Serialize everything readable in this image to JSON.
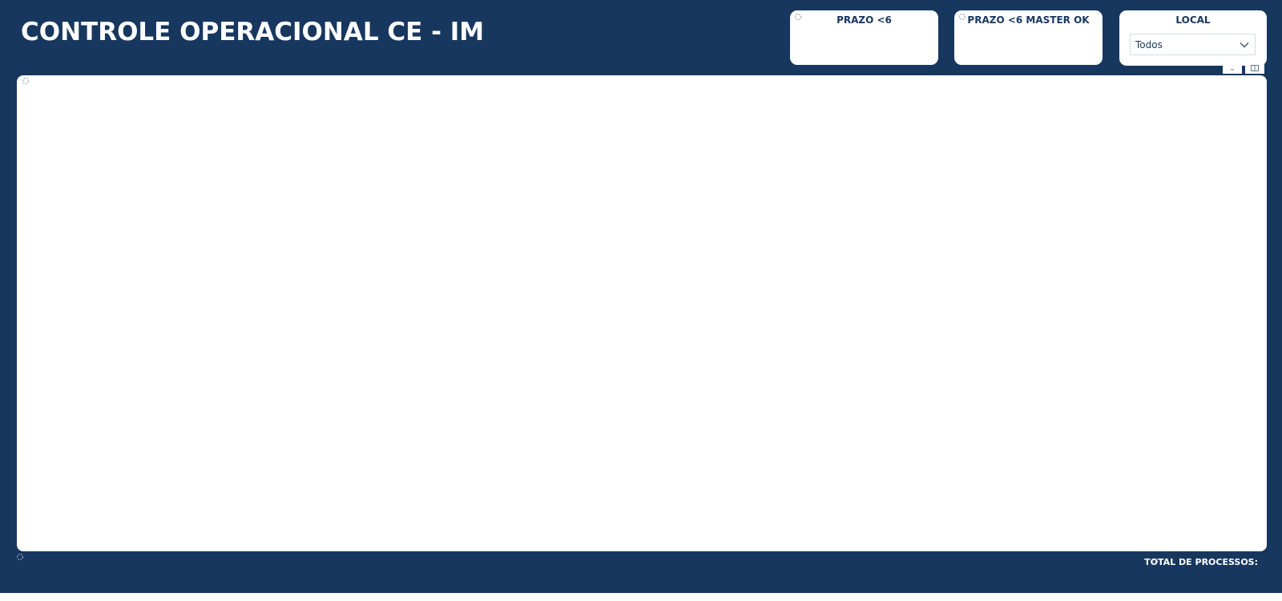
{
  "header": {
    "title": "CONTROLE OPERACIONAL CE - IM"
  },
  "cards": {
    "prazo": {
      "title": "PRAZO <6"
    },
    "prazo_master": {
      "title": "PRAZO <6 MASTER OK"
    },
    "local": {
      "title": "LOCAL",
      "selected": "Todos"
    }
  },
  "footer": {
    "total_label": "TOTAL DE PROCESSOS:"
  },
  "icons": {
    "loading": "loading-spinner-icon",
    "dropdown": "chevron-down-icon",
    "focus_mode": "focus-mode-icon",
    "more_options": "more-options-icon"
  },
  "colors": {
    "background": "#17375e",
    "panel": "#ffffff",
    "card_text": "#17375e"
  }
}
